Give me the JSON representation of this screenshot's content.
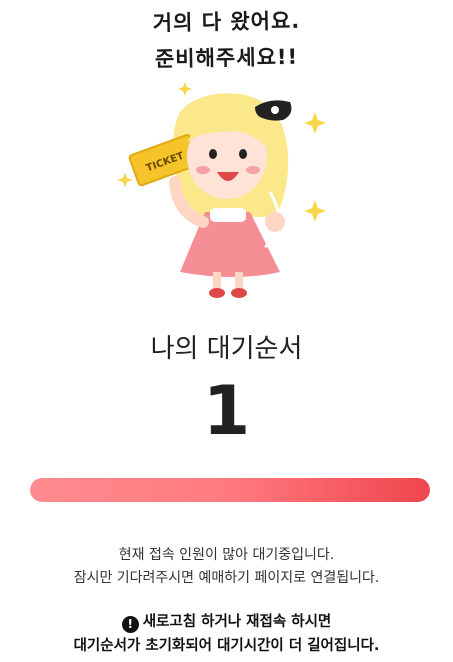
{
  "hero": {
    "line1": "거의 다 왔어요.",
    "line2": "준비해주세요!!",
    "ticket_label": "TICKET"
  },
  "queue": {
    "title": "나의 대기순서",
    "number": "1",
    "progress": 1.0
  },
  "notice": {
    "line1": "현재 접속 인원이 많아 대기중입니다.",
    "line2": "잠시만 기다려주시면 예매하기 페이지로 연결됩니다."
  },
  "warning": {
    "icon": "exclamation-icon",
    "line1": "새로고침 하거나 재접속 하시면",
    "line2": "대기순서가 초기화되어 대기시간이 더 길어집니다."
  },
  "colors": {
    "accent": "#f0454d",
    "accent_light": "#ff8c90",
    "hair": "#fbe88a",
    "dress": "#f58f95",
    "ticket": "#f5c42a"
  }
}
